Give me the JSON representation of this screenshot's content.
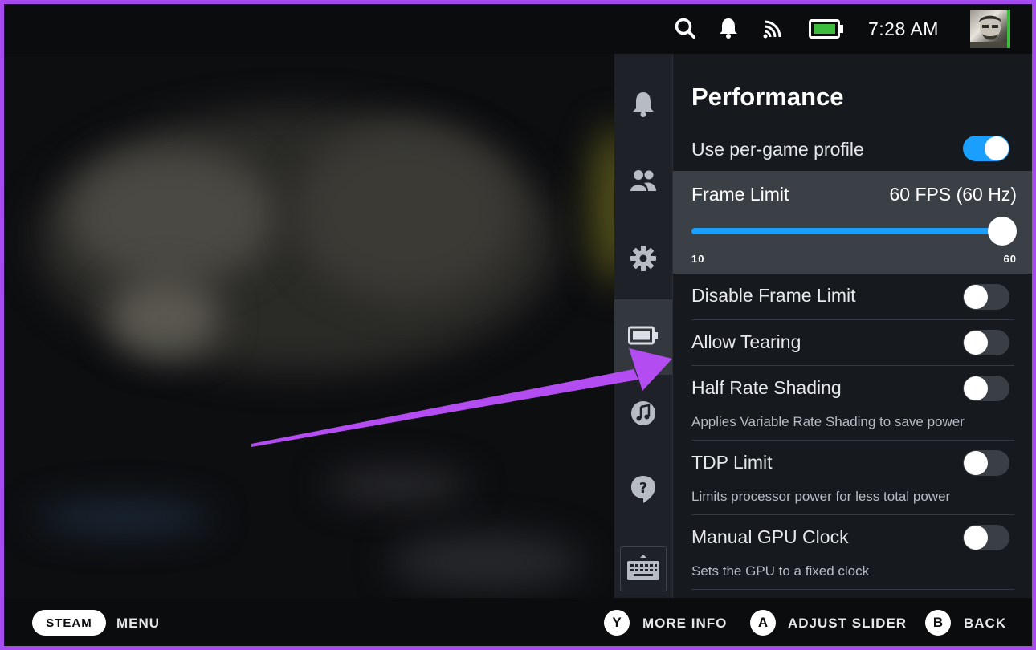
{
  "statusbar": {
    "time": "7:28 AM",
    "icons": [
      "search-icon",
      "notification-bell-icon",
      "cast-icon",
      "battery-icon"
    ],
    "battery_color": "#3dbb3c"
  },
  "rail": {
    "items": [
      "notifications-icon",
      "friends-icon",
      "settings-icon",
      "performance-battery-icon",
      "music-icon",
      "help-icon"
    ],
    "active": "performance-battery-icon",
    "keyboard": "keyboard-icon"
  },
  "panel": {
    "title": "Performance",
    "per_game_profile": {
      "label": "Use per-game profile",
      "on": true
    },
    "frame_limit": {
      "label": "Frame Limit",
      "value": "60 FPS (60 Hz)",
      "min": "10",
      "max": "60",
      "level": 1.0
    },
    "rows": [
      {
        "label": "Disable Frame Limit",
        "desc": "",
        "on": false
      },
      {
        "label": "Allow Tearing",
        "desc": "",
        "on": false
      },
      {
        "label": "Half Rate Shading",
        "desc": "Applies Variable Rate Shading to save power",
        "on": false
      },
      {
        "label": "TDP Limit",
        "desc": "Limits processor power for less total power",
        "on": false
      },
      {
        "label": "Manual GPU Clock",
        "desc": "Sets the GPU to a fixed clock",
        "on": false
      }
    ]
  },
  "bottombar": {
    "steam": "STEAM",
    "menu": "MENU",
    "y_key": "Y",
    "y_label": "MORE INFO",
    "a_key": "A",
    "a_label": "ADJUST SLIDER",
    "b_key": "B",
    "b_label": "BACK"
  },
  "colors": {
    "accent": "#1a9fff",
    "frame": "#a54bf0",
    "annotation_arrow": "#b34df2"
  }
}
